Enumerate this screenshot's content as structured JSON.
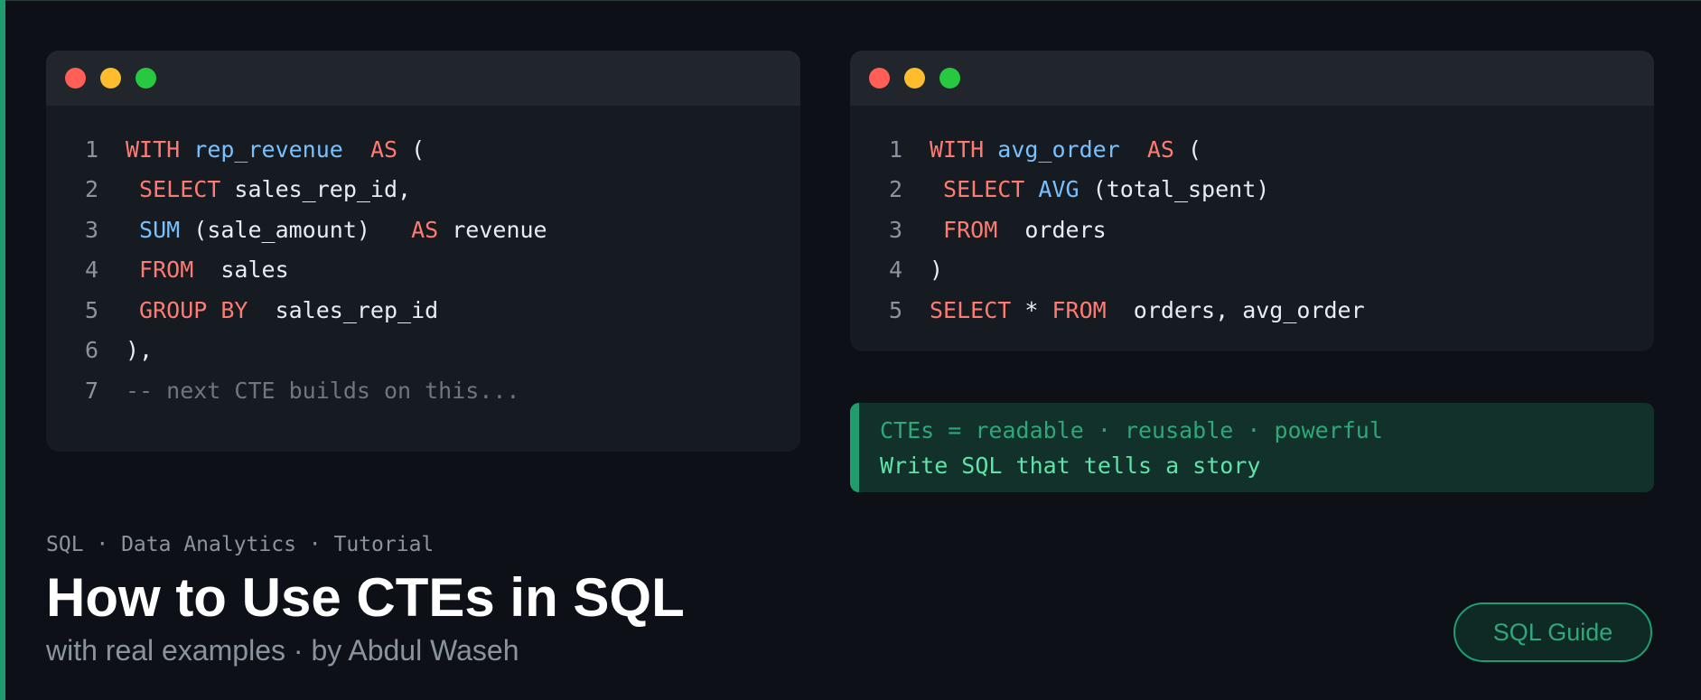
{
  "left_panel": {
    "lines": [
      {
        "num": "1",
        "tokens": [
          {
            "t": "WITH ",
            "c": "kw"
          },
          {
            "t": "rep_revenue  ",
            "c": "fn"
          },
          {
            "t": "AS ",
            "c": "kw"
          },
          {
            "t": "(",
            "c": "tx"
          }
        ]
      },
      {
        "num": "2",
        "tokens": [
          {
            "t": " SELECT ",
            "c": "kw"
          },
          {
            "t": "sales_rep_id,",
            "c": "tx"
          }
        ]
      },
      {
        "num": "3",
        "tokens": [
          {
            "t": " SUM ",
            "c": "fn"
          },
          {
            "t": "(sale_amount)   ",
            "c": "tx"
          },
          {
            "t": "AS ",
            "c": "kw"
          },
          {
            "t": "revenue",
            "c": "tx"
          }
        ]
      },
      {
        "num": "4",
        "tokens": [
          {
            "t": " FROM  ",
            "c": "kw"
          },
          {
            "t": "sales",
            "c": "tx"
          }
        ]
      },
      {
        "num": "5",
        "tokens": [
          {
            "t": " GROUP BY  ",
            "c": "kw"
          },
          {
            "t": "sales_rep_id",
            "c": "tx"
          }
        ]
      },
      {
        "num": "6",
        "tokens": [
          {
            "t": "),",
            "c": "tx"
          }
        ]
      },
      {
        "num": "7",
        "tokens": [
          {
            "t": "-- next CTE builds on this...",
            "c": "cm"
          }
        ]
      }
    ]
  },
  "right_panel": {
    "lines": [
      {
        "num": "1",
        "tokens": [
          {
            "t": "WITH ",
            "c": "kw"
          },
          {
            "t": "avg_order  ",
            "c": "fn"
          },
          {
            "t": "AS ",
            "c": "kw"
          },
          {
            "t": "(",
            "c": "tx"
          }
        ]
      },
      {
        "num": "2",
        "tokens": [
          {
            "t": " SELECT ",
            "c": "kw"
          },
          {
            "t": "AVG ",
            "c": "fn"
          },
          {
            "t": "(total_spent)",
            "c": "tx"
          }
        ]
      },
      {
        "num": "3",
        "tokens": [
          {
            "t": " FROM  ",
            "c": "kw"
          },
          {
            "t": "orders",
            "c": "tx"
          }
        ]
      },
      {
        "num": "4",
        "tokens": [
          {
            "t": ")",
            "c": "tx"
          }
        ]
      },
      {
        "num": "5",
        "tokens": [
          {
            "t": "SELECT ",
            "c": "kw"
          },
          {
            "t": "* ",
            "c": "tx"
          },
          {
            "t": "FROM  ",
            "c": "kw"
          },
          {
            "t": "orders, avg_order",
            "c": "tx"
          }
        ]
      }
    ]
  },
  "note": {
    "line1": "CTEs = readable · reusable · powerful",
    "line2": "Write SQL that tells a story"
  },
  "footer": {
    "tags": "SQL · Data Analytics · Tutorial",
    "title": "How to Use CTEs in SQL",
    "subtitle": "with real examples · by Abdul Waseh",
    "badge": "SQL Guide"
  },
  "window_controls": [
    "close-dot",
    "minimize-dot",
    "maximize-dot"
  ],
  "colors": {
    "background": "#0d1117",
    "panel": "#161b22",
    "keyword": "#ff7b72",
    "function": "#79c0ff",
    "comment": "#6e7681",
    "accent": "#1f9d6f"
  }
}
